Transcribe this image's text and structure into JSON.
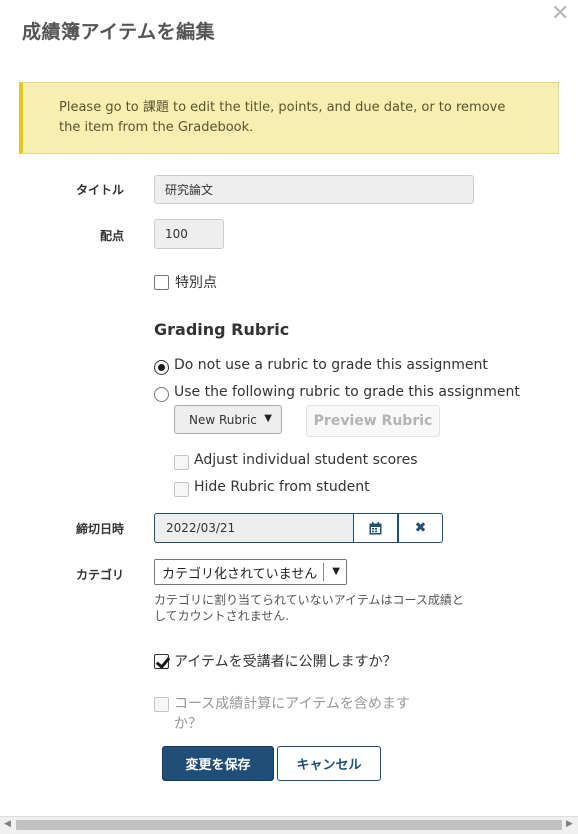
{
  "dialog": {
    "title": "成績簿アイテムを編集",
    "close_symbol": "✕"
  },
  "notice": {
    "text": "Please go to 課題 to edit the title, points, and due date, or to remove the item from the Gradebook."
  },
  "form": {
    "title_label": "タイトル",
    "title_value": "研究論文",
    "points_label": "配点",
    "points_value": "100",
    "extra_credit_label": "特別点",
    "extra_credit_checked": false
  },
  "rubric": {
    "heading": "Grading Rubric",
    "option_none": "Do not use a rubric to grade this assignment",
    "option_use": "Use the following rubric to grade this assignment",
    "selected_option": "none",
    "select_value": "New Rubric",
    "preview_button": "Preview Rubric",
    "adjust_scores_label": "Adjust individual student scores",
    "hide_rubric_label": "Hide Rubric from student"
  },
  "due_date": {
    "label": "締切日時",
    "value": "2022/03/21",
    "calendar_icon": "calendar-icon",
    "clear_icon": "times-icon"
  },
  "category": {
    "label": "カテゴリ",
    "selected": "カテゴリ化されていません",
    "help_text": "カテゴリに割り当てられていないアイテムはコース成績としてカウントされません."
  },
  "release": {
    "label": "アイテムを受講者に公開しますか？",
    "checked": true
  },
  "include": {
    "label_line1": "コース成績計算にアイテムを含めます",
    "label_line2": "か？",
    "checked": false,
    "disabled": true
  },
  "buttons": {
    "save": "変更を保存",
    "cancel": "キャンセル"
  },
  "colors": {
    "primary": "#1f4e79",
    "notice_bg": "#f7efb1",
    "notice_border": "#e3c430"
  }
}
